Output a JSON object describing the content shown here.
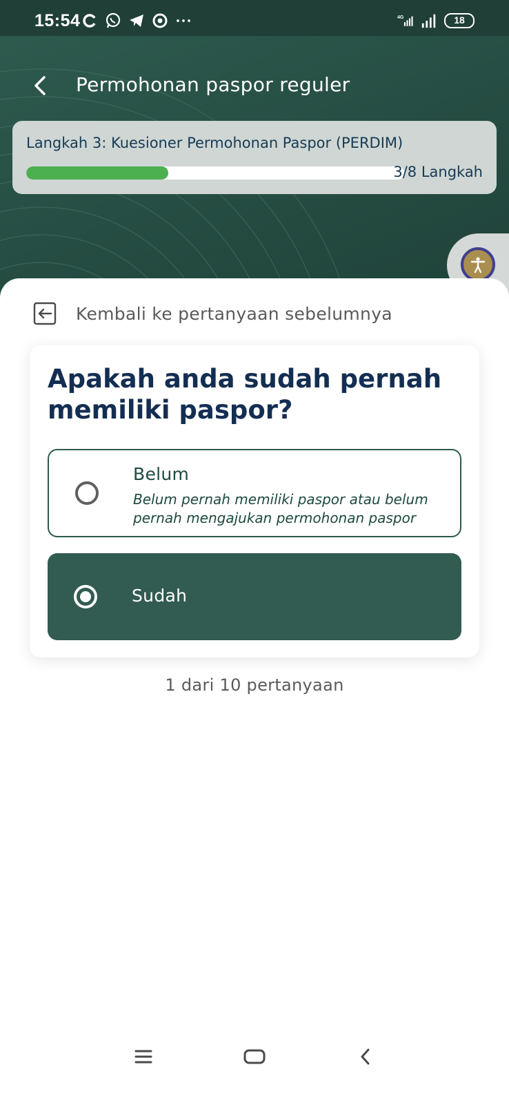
{
  "status_bar": {
    "time": "15:54",
    "battery": "18",
    "network": "4G",
    "icons_left": [
      "sync-icon",
      "whatsapp-icon",
      "telegram-icon",
      "target-icon",
      "more-dots-icon"
    ],
    "icons_right": [
      "signal-4g-icon",
      "signal-icon",
      "battery-icon"
    ]
  },
  "header": {
    "title": "Permohonan paspor reguler"
  },
  "progress": {
    "step_label": "Langkah 3: Kuesioner Permohonan Paspor (PERDIM)",
    "count_label": "3/8 Langkah",
    "fraction": 0.375
  },
  "back_to_previous": "Kembali ke pertanyaan sebelumnya",
  "question": {
    "title": "Apakah anda sudah pernah memiliki paspor?",
    "options": [
      {
        "label": "Belum",
        "description": "Belum pernah memiliki paspor atau belum pernah mengajukan permohonan paspor",
        "selected": false
      },
      {
        "label": "Sudah",
        "description": "",
        "selected": true
      }
    ]
  },
  "question_count": "1 dari 10 pertanyaan",
  "colors": {
    "primary": "#325b51",
    "progress_fill": "#4caf50",
    "title_text": "#142e52"
  }
}
